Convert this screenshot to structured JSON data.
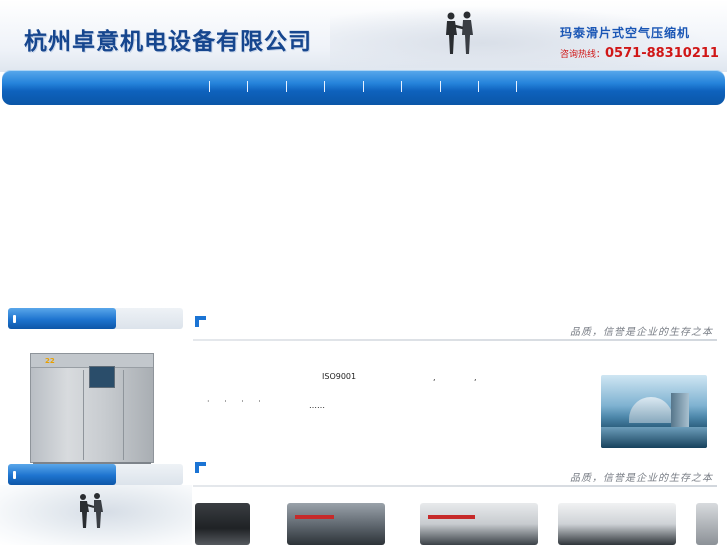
{
  "header": {
    "company_name": "杭州卓意机电设备有限公司",
    "product_title": "玛泰滑片式空气压缩机",
    "hotline_label": "咨询热线：",
    "hotline_number": "0571-88310211"
  },
  "nav": {
    "separators": 9
  },
  "sidebar": {
    "machine_badge": "22"
  },
  "about_section": {
    "slogan": "品质，信誉是企业的生存之本",
    "text_iso": "ISO9001",
    "text_punct_1": ",",
    "text_punct_2": ",",
    "text_dots": "· · · ·",
    "text_more": "……"
  },
  "products_section": {
    "slogan": "品质，信誉是企业的生存之本"
  },
  "colors": {
    "brand_blue": "#16468e",
    "nav_blue": "#1e74cf",
    "hotline_red": "#d01717",
    "accent_blue": "#1b74d4"
  }
}
